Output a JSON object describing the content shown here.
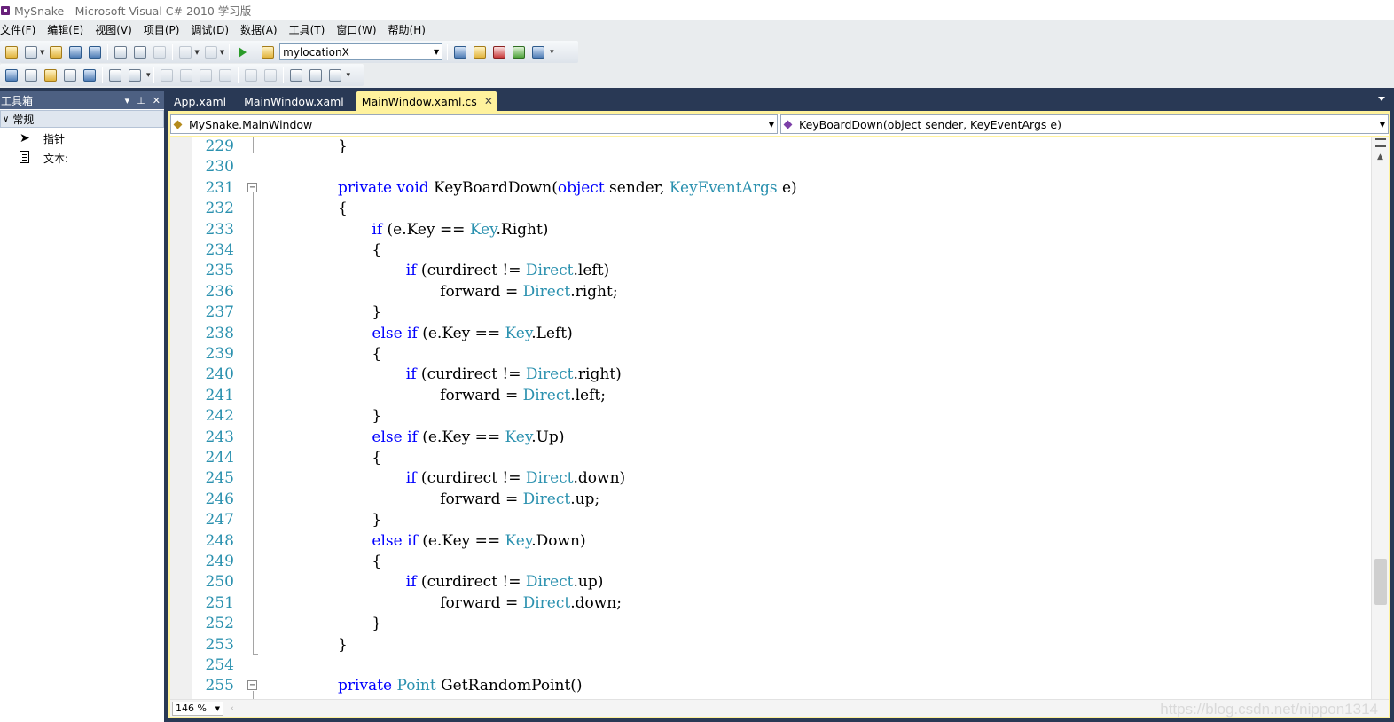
{
  "window": {
    "title": "MySnake - Microsoft Visual C# 2010 学习版"
  },
  "menu": [
    "文件(F)",
    "编辑(E)",
    "视图(V)",
    "项目(P)",
    "调试(D)",
    "数据(A)",
    "工具(T)",
    "窗口(W)",
    "帮助(H)"
  ],
  "toolbar": {
    "config_combo_value": "mylocationX"
  },
  "toolbox": {
    "title": "工具箱",
    "group": "常规",
    "items": [
      {
        "label": "指针",
        "icon": "pointer-icon"
      },
      {
        "label": "文本:",
        "icon": "text-document-icon"
      }
    ]
  },
  "tabs": [
    {
      "label": "App.xaml",
      "active": false
    },
    {
      "label": "MainWindow.xaml",
      "active": false
    },
    {
      "label": "MainWindow.xaml.cs",
      "active": true
    }
  ],
  "navbar": {
    "class_combo": "MySnake.MainWindow",
    "member_combo": "KeyBoardDown(object sender, KeyEventArgs e)"
  },
  "editor": {
    "zoom": "146 %",
    "lines": [
      {
        "n": "229",
        "indent": 8,
        "segs": [
          [
            "}",
            ""
          ]
        ]
      },
      {
        "n": "230",
        "indent": 0,
        "segs": []
      },
      {
        "n": "231",
        "indent": 8,
        "fold": "−",
        "segs": [
          [
            "private",
            "kw"
          ],
          [
            " ",
            ""
          ],
          [
            "void",
            "kw"
          ],
          [
            " KeyBoardDown(",
            ""
          ],
          [
            "object",
            "kw"
          ],
          [
            " sender, ",
            ""
          ],
          [
            "KeyEventArgs",
            "ty"
          ],
          [
            " e)",
            ""
          ]
        ]
      },
      {
        "n": "232",
        "indent": 8,
        "segs": [
          [
            "{",
            ""
          ]
        ]
      },
      {
        "n": "233",
        "indent": 12,
        "segs": [
          [
            "if",
            "kw"
          ],
          [
            " (e.Key == ",
            ""
          ],
          [
            "Key",
            "ty"
          ],
          [
            ".Right)",
            ""
          ]
        ]
      },
      {
        "n": "234",
        "indent": 12,
        "segs": [
          [
            "{",
            ""
          ]
        ]
      },
      {
        "n": "235",
        "indent": 16,
        "segs": [
          [
            "if",
            "kw"
          ],
          [
            " (curdirect != ",
            ""
          ],
          [
            "Direct",
            "ty"
          ],
          [
            ".left)",
            ""
          ]
        ]
      },
      {
        "n": "236",
        "indent": 20,
        "segs": [
          [
            "forward = ",
            ""
          ],
          [
            "Direct",
            "ty"
          ],
          [
            ".right;",
            ""
          ]
        ]
      },
      {
        "n": "237",
        "indent": 12,
        "segs": [
          [
            "}",
            ""
          ]
        ]
      },
      {
        "n": "238",
        "indent": 12,
        "segs": [
          [
            "else",
            "kw"
          ],
          [
            " ",
            ""
          ],
          [
            "if",
            "kw"
          ],
          [
            " (e.Key == ",
            ""
          ],
          [
            "Key",
            "ty"
          ],
          [
            ".Left)",
            ""
          ]
        ]
      },
      {
        "n": "239",
        "indent": 12,
        "segs": [
          [
            "{",
            ""
          ]
        ]
      },
      {
        "n": "240",
        "indent": 16,
        "segs": [
          [
            "if",
            "kw"
          ],
          [
            " (curdirect != ",
            ""
          ],
          [
            "Direct",
            "ty"
          ],
          [
            ".right)",
            ""
          ]
        ]
      },
      {
        "n": "241",
        "indent": 20,
        "segs": [
          [
            "forward = ",
            ""
          ],
          [
            "Direct",
            "ty"
          ],
          [
            ".left;",
            ""
          ]
        ]
      },
      {
        "n": "242",
        "indent": 12,
        "segs": [
          [
            "}",
            ""
          ]
        ]
      },
      {
        "n": "243",
        "indent": 12,
        "segs": [
          [
            "else",
            "kw"
          ],
          [
            " ",
            ""
          ],
          [
            "if",
            "kw"
          ],
          [
            " (e.Key == ",
            ""
          ],
          [
            "Key",
            "ty"
          ],
          [
            ".Up)",
            ""
          ]
        ]
      },
      {
        "n": "244",
        "indent": 12,
        "segs": [
          [
            "{",
            ""
          ]
        ]
      },
      {
        "n": "245",
        "indent": 16,
        "segs": [
          [
            "if",
            "kw"
          ],
          [
            " (curdirect != ",
            ""
          ],
          [
            "Direct",
            "ty"
          ],
          [
            ".down)",
            ""
          ]
        ]
      },
      {
        "n": "246",
        "indent": 20,
        "segs": [
          [
            "forward = ",
            ""
          ],
          [
            "Direct",
            "ty"
          ],
          [
            ".up;",
            ""
          ]
        ]
      },
      {
        "n": "247",
        "indent": 12,
        "segs": [
          [
            "}",
            ""
          ]
        ]
      },
      {
        "n": "248",
        "indent": 12,
        "segs": [
          [
            "else",
            "kw"
          ],
          [
            " ",
            ""
          ],
          [
            "if",
            "kw"
          ],
          [
            " (e.Key == ",
            ""
          ],
          [
            "Key",
            "ty"
          ],
          [
            ".Down)",
            ""
          ]
        ]
      },
      {
        "n": "249",
        "indent": 12,
        "segs": [
          [
            "{",
            ""
          ]
        ]
      },
      {
        "n": "250",
        "indent": 16,
        "segs": [
          [
            "if",
            "kw"
          ],
          [
            " (curdirect != ",
            ""
          ],
          [
            "Direct",
            "ty"
          ],
          [
            ".up)",
            ""
          ]
        ]
      },
      {
        "n": "251",
        "indent": 20,
        "segs": [
          [
            "forward = ",
            ""
          ],
          [
            "Direct",
            "ty"
          ],
          [
            ".down;",
            ""
          ]
        ]
      },
      {
        "n": "252",
        "indent": 12,
        "segs": [
          [
            "}",
            ""
          ]
        ]
      },
      {
        "n": "253",
        "indent": 8,
        "segs": [
          [
            "}",
            ""
          ]
        ]
      },
      {
        "n": "254",
        "indent": 0,
        "segs": []
      },
      {
        "n": "255",
        "indent": 8,
        "fold": "−",
        "segs": [
          [
            "private",
            "kw"
          ],
          [
            " ",
            ""
          ],
          [
            "Point",
            "ty"
          ],
          [
            " GetRandomPoint()",
            ""
          ]
        ]
      }
    ]
  },
  "watermark": "https://blog.csdn.net/nippon1314",
  "colors": {
    "keyword": "#0000ff",
    "type": "#2b91af",
    "line_number": "#2b91af",
    "chrome": "#293955",
    "active_tab": "#fff29d"
  }
}
